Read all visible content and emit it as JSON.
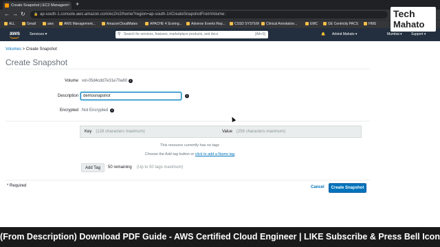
{
  "browser": {
    "tab_title": "Create Snapshot | EC2 Managem",
    "tab_close": "×",
    "new_tab": "+",
    "url": "ap-south-1.console.aws.amazon.com/ec2/v2/home?region=ap-south-1#CreateSnapshotFromVolume:",
    "bookmarks": [
      "ALL",
      "Gmail",
      "aws",
      "AWS Management...",
      "AmazonCloudMates",
      "APACHE 4 Scoring...",
      "Adverse Events Rep...",
      "CSSD SYSTEM",
      "Clinical Annotation...",
      "EMC",
      "GE Centricity PACS",
      "HMS"
    ]
  },
  "logo": {
    "line1": "Tech",
    "line2": "Mahato"
  },
  "aws_nav": {
    "logo": "aws",
    "services": "Services ▾",
    "search_placeholder": "Search for services, features, marketplace products, and docs",
    "search_shortcut": "[Alt+S]",
    "user": "Arbind Mahato ▾",
    "region": "Mumbai ▾",
    "support": "Support ▾"
  },
  "breadcrumb": {
    "link": "Volumes",
    "separator": " > ",
    "current": "Create Snapshot"
  },
  "page_title": "Create Snapshot",
  "form": {
    "volume_label": "Volume",
    "volume_value": "vol-05d4cdd7e31e70a80",
    "description_label": "Description",
    "description_value": "demosnapshot",
    "encrypted_label": "Encrypted",
    "encrypted_value": "Not Encrypted"
  },
  "tags": {
    "key_header": "Key",
    "key_hint": "(128 characters maximum)",
    "value_header": "Value",
    "value_hint": "(256 characters maximum)",
    "empty_text": "This resource currently has no tags",
    "add_hint_prefix": "Choose the Add tag button or",
    "add_hint_link": "click to add a Name tag",
    "add_tag_button": "Add Tag",
    "remaining": "50 remaining",
    "limit": "(Up to 50 tags maximum)"
  },
  "footer": {
    "required": "* Required",
    "cancel": "Cancel",
    "create": "Create Snapshot"
  },
  "info_glyph": "i",
  "banner": "(From Description) Download PDF Guide - AWS Certified Cloud Engineer | LIKE Subscribe & Press Bell Icon",
  "colors": {
    "aws_nav": "#232f3e",
    "primary": "#0073bb",
    "accent": "#ff9900"
  }
}
